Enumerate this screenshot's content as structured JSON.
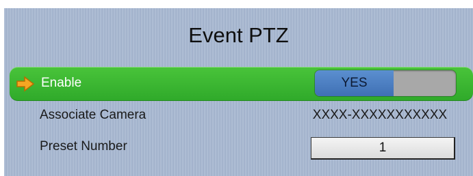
{
  "header": {
    "title": "Event PTZ"
  },
  "rows": {
    "enable": {
      "label": "Enable",
      "value": "YES"
    },
    "associate_camera": {
      "label": "Associate Camera",
      "value": "XXXX-XXXXXXXXXXX"
    },
    "preset_number": {
      "label": "Preset Number",
      "value": "1"
    }
  },
  "icons": {
    "selection": "arrow-right-icon"
  },
  "colors": {
    "panel_bg": "#a9b9d1",
    "selected_row": "#3cb634",
    "toggle_on": "#4e80c3",
    "toggle_off": "#a8a8a8",
    "selection_arrow": "#f5a623"
  }
}
